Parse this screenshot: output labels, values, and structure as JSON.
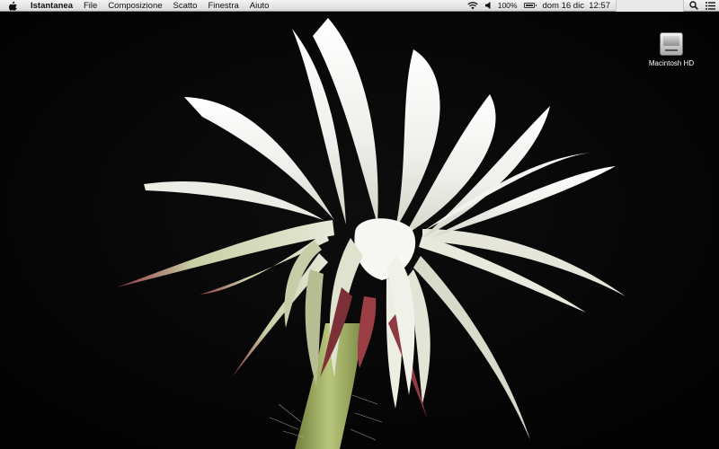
{
  "menubar": {
    "apple_icon": "apple-icon",
    "app_name": "Istantanea",
    "menus": [
      "File",
      "Composizione",
      "Scatto",
      "Finestra",
      "Aiuto"
    ],
    "status": {
      "wifi_icon": "wifi-icon",
      "volume_icon": "volume-icon",
      "battery_percent": "100%",
      "battery_icon": "battery-icon",
      "clock": "dom 16 dic  12:57",
      "spotlight_icon": "search-icon",
      "notifications_icon": "list-icon"
    }
  },
  "desktop": {
    "wallpaper": "white cactus flower on black background",
    "icons": [
      {
        "label": "Macintosh HD",
        "icon": "hard-drive-icon"
      }
    ]
  },
  "colors": {
    "menubar_bg": "#e6e6e6",
    "desktop_bg": "#050505",
    "petal": "#f2f2ee",
    "stem": "#a9b86a",
    "sepal_tip": "#7a2b33"
  }
}
